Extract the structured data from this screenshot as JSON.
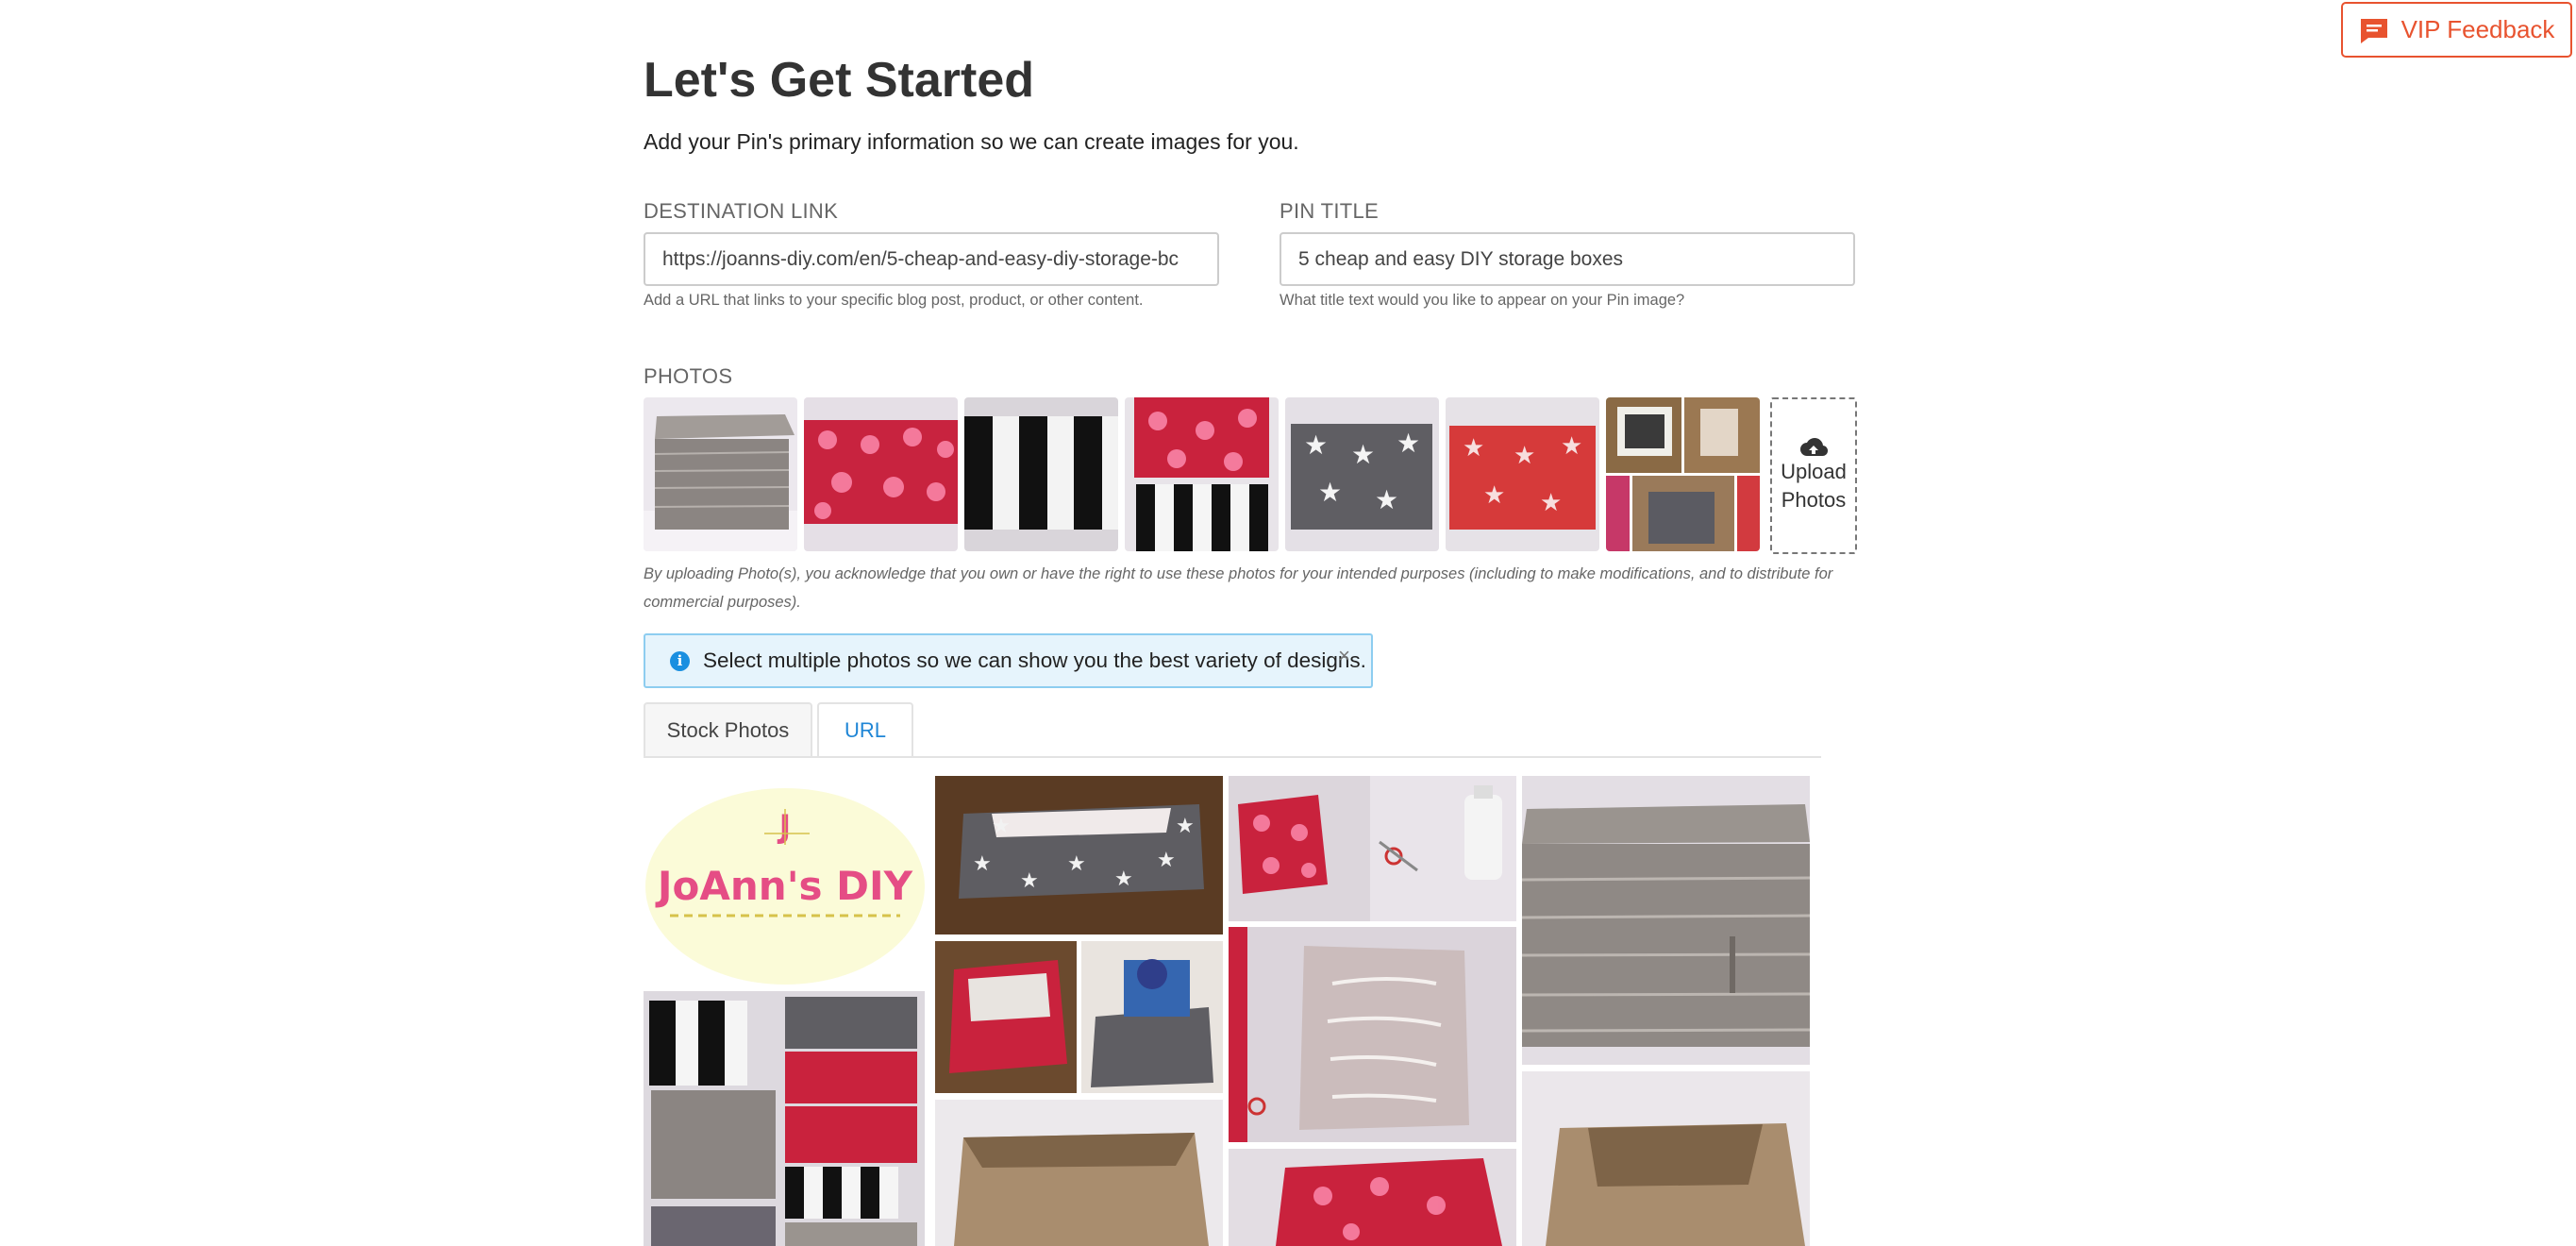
{
  "feedback_button": {
    "label": "VIP Feedback"
  },
  "header": {
    "title": "Let's Get Started",
    "subtitle": "Add your Pin's primary information so we can create images for you."
  },
  "destination": {
    "label": "DESTINATION LINK",
    "value": "https://joanns-diy.com/en/5-cheap-and-easy-diy-storage-bc",
    "help": "Add a URL that links to your specific blog post, product, or other content."
  },
  "pin_title": {
    "label": "PIN TITLE",
    "value": "5 cheap and easy DIY storage boxes",
    "help": "What title text would you like to appear on your Pin image?"
  },
  "photos": {
    "label": "PHOTOS",
    "upload_label": "Upload Photos",
    "disclaimer": "By uploading Photo(s), you acknowledge that you own or have the right to use these photos for your intended purposes (including to make modifications, and to distribute for commercial purposes)."
  },
  "alert": {
    "message": "Select multiple photos so we can show you the best variety of designs.",
    "close": "×"
  },
  "tabs": [
    {
      "label": "Stock Photos"
    },
    {
      "label": "URL"
    }
  ],
  "logo_text": "JoAnn's DIY",
  "colors": {
    "accent": "#e8532f",
    "link": "#1f86d6",
    "info": "#1a8fe0"
  }
}
